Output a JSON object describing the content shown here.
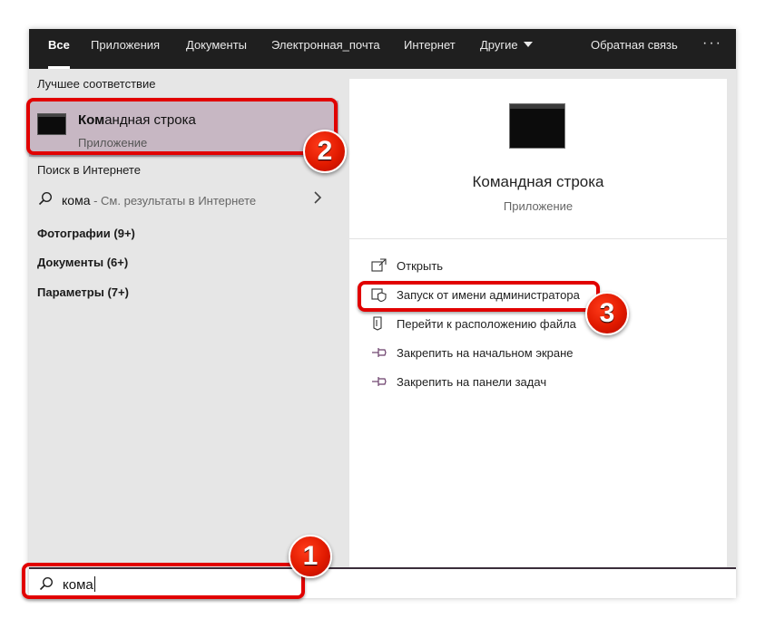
{
  "nav": {
    "tabs": [
      {
        "label": "Все",
        "active": true
      },
      {
        "label": "Приложения"
      },
      {
        "label": "Документы"
      },
      {
        "label": "Электронная_почта"
      },
      {
        "label": "Интернет"
      },
      {
        "label": "Другие",
        "has_dropdown": true
      }
    ],
    "feedback": "Обратная связь",
    "more": "···"
  },
  "left": {
    "best_match_header": "Лучшее соответствие",
    "best_match": {
      "title_bold": "Ком",
      "title_rest": "андная строка",
      "subtitle": "Приложение",
      "icon": "terminal-icon"
    },
    "web_header": "Поиск в Интернете",
    "web_result": {
      "query": "кома",
      "hint": " - См. результаты в Интернете",
      "icon": "search-icon",
      "chevron_icon": "chevron-right-icon"
    },
    "categories": [
      {
        "label": "Фотографии (9+)"
      },
      {
        "label": "Документы (6+)"
      },
      {
        "label": "Параметры (7+)"
      }
    ]
  },
  "preview": {
    "app_name": "Командная строка",
    "app_kind": "Приложение",
    "icon": "terminal-icon",
    "actions": [
      {
        "label": "Открыть",
        "icon": "open-icon"
      },
      {
        "label": "Запуск от имени администратора",
        "icon": "admin-shield-icon"
      },
      {
        "label": "Перейти к расположению файла",
        "icon": "file-location-icon"
      },
      {
        "label": "Закрепить на начальном экране",
        "icon": "pin-icon"
      },
      {
        "label": "Закрепить на панели задач",
        "icon": "pin-icon"
      }
    ]
  },
  "search": {
    "value": "кома",
    "icon": "search-icon"
  },
  "callouts": [
    {
      "number": "1",
      "target": "search-box"
    },
    {
      "number": "2",
      "target": "best-match"
    },
    {
      "number": "3",
      "target": "run-as-admin"
    }
  ],
  "colors": {
    "topbar": "#1f1f1f",
    "selection": "#c7b7c3",
    "callout_red": "#e10000",
    "search_accent": "#3a2d3a"
  }
}
